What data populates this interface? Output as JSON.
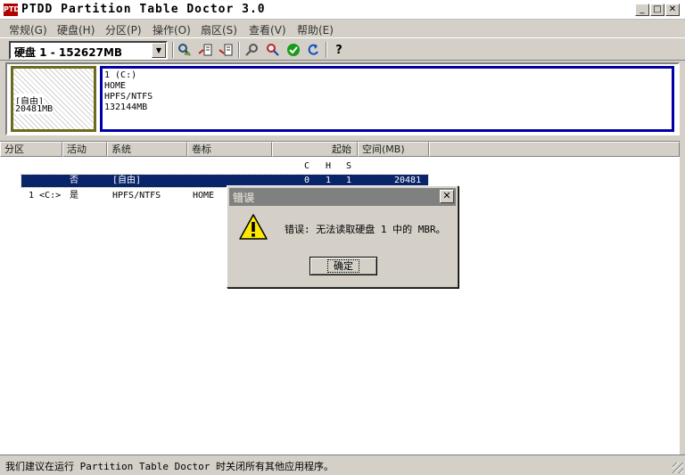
{
  "window": {
    "title": "PTDD Partition Table Doctor 3.0",
    "icon_text": "PTD",
    "min_glyph": "_",
    "max_glyph": "□",
    "close_glyph": "✕"
  },
  "menu": [
    "常规(G)",
    "硬盘(H)",
    "分区(P)",
    "操作(O)",
    "扇区(S)",
    "查看(V)",
    "帮助(E)"
  ],
  "toolbar": {
    "disk_selector": "硬盘 1 - 152627MB",
    "icons": [
      "scan-disk-icon",
      "backup-icon",
      "restore-icon",
      "properties-icon",
      "find-icon",
      "check-icon",
      "undo-icon",
      "help-icon"
    ]
  },
  "disk_map": {
    "free": {
      "name": "[自由]",
      "size": "20481MB"
    },
    "partition": {
      "index": "1 (C:)",
      "label": "HOME",
      "fs": "HPFS/NTFS",
      "size": "132144MB"
    }
  },
  "list": {
    "columns": [
      "分区",
      "活动",
      "系统",
      "卷标",
      "起始",
      "空间(MB)"
    ],
    "chs_headers": [
      "C",
      "H",
      "S"
    ],
    "rows": [
      {
        "partition": "",
        "active": "否",
        "system": "[自由]",
        "label": "",
        "c": "0",
        "h": "1",
        "s": "1",
        "size": "20481"
      },
      {
        "partition": "1 <C:>",
        "active": "是",
        "system": "HPFS/NTFS",
        "label": "HOME",
        "c": "",
        "h": "",
        "s": "",
        "size": ""
      }
    ]
  },
  "status": "我们建议在运行 Partition Table Doctor 时关闭所有其他应用程序。",
  "dialog": {
    "title": "错误",
    "close_glyph": "✕",
    "message": "错误: 无法读取硬盘 1 中的 MBR。",
    "ok_label": "确定"
  },
  "colors": {
    "selection": "#0a246a",
    "partition_border": "#0000a8",
    "free_border": "#6e6a1e",
    "dialog_title_inactive": "#808080"
  }
}
